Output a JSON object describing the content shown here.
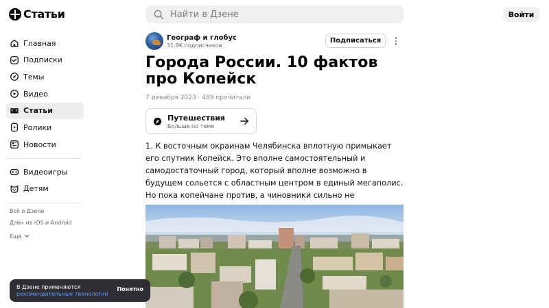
{
  "header": {
    "logo_text": "Статьи",
    "search_placeholder": "Найти в Дзене",
    "login_label": "Войти"
  },
  "sidebar": {
    "items": [
      {
        "label": "Главная",
        "icon": "home-icon",
        "active": false
      },
      {
        "label": "Подписки",
        "icon": "subscriptions-icon",
        "active": false
      },
      {
        "label": "Темы",
        "icon": "compass-icon",
        "active": false
      },
      {
        "label": "Видео",
        "icon": "video-icon",
        "active": false
      },
      {
        "label": "Статьи",
        "icon": "articles-icon",
        "active": true
      },
      {
        "label": "Ролики",
        "icon": "clips-icon",
        "active": false
      },
      {
        "label": "Новости",
        "icon": "news-icon",
        "active": false
      }
    ],
    "secondary_items": [
      {
        "label": "Видеоигры",
        "icon": "gamepad-icon"
      },
      {
        "label": "Детям",
        "icon": "kids-icon"
      }
    ],
    "footer_links": [
      "Всё о Дзене",
      "Дзен на iOS и Android"
    ],
    "more_label": "Ещё"
  },
  "article": {
    "author_name": "Географ и глобус",
    "author_subscribers": "31,9K подписчиков",
    "subscribe_label": "Подписаться",
    "title": "Города России. 10 фактов про Копейск",
    "meta": "7 декабря 2023 · 489 прочитали",
    "topic": {
      "name": "Путешествия",
      "subtitle": "Больше по теме"
    },
    "paragraph": "1. К восточным окраинам Челябинска вплотную примыкает его спутник Копейск. Это вполне самостоятельный и самодостаточный город, который вполне возможно в будущем сольется с областным центром в единый мегаполис. Но пока копейчане против, а чиновники сильно не педалируют эту тему;"
  },
  "toast": {
    "text": "В Дзене применяются",
    "link_text": "рекомендательные технологии",
    "button_label": "Понятно"
  },
  "colors": {
    "link_blue": "#5b9bff",
    "toast_bg": "#2f2f33",
    "search_bg": "#f0f0f2",
    "active_bg": "#eeeef0"
  }
}
